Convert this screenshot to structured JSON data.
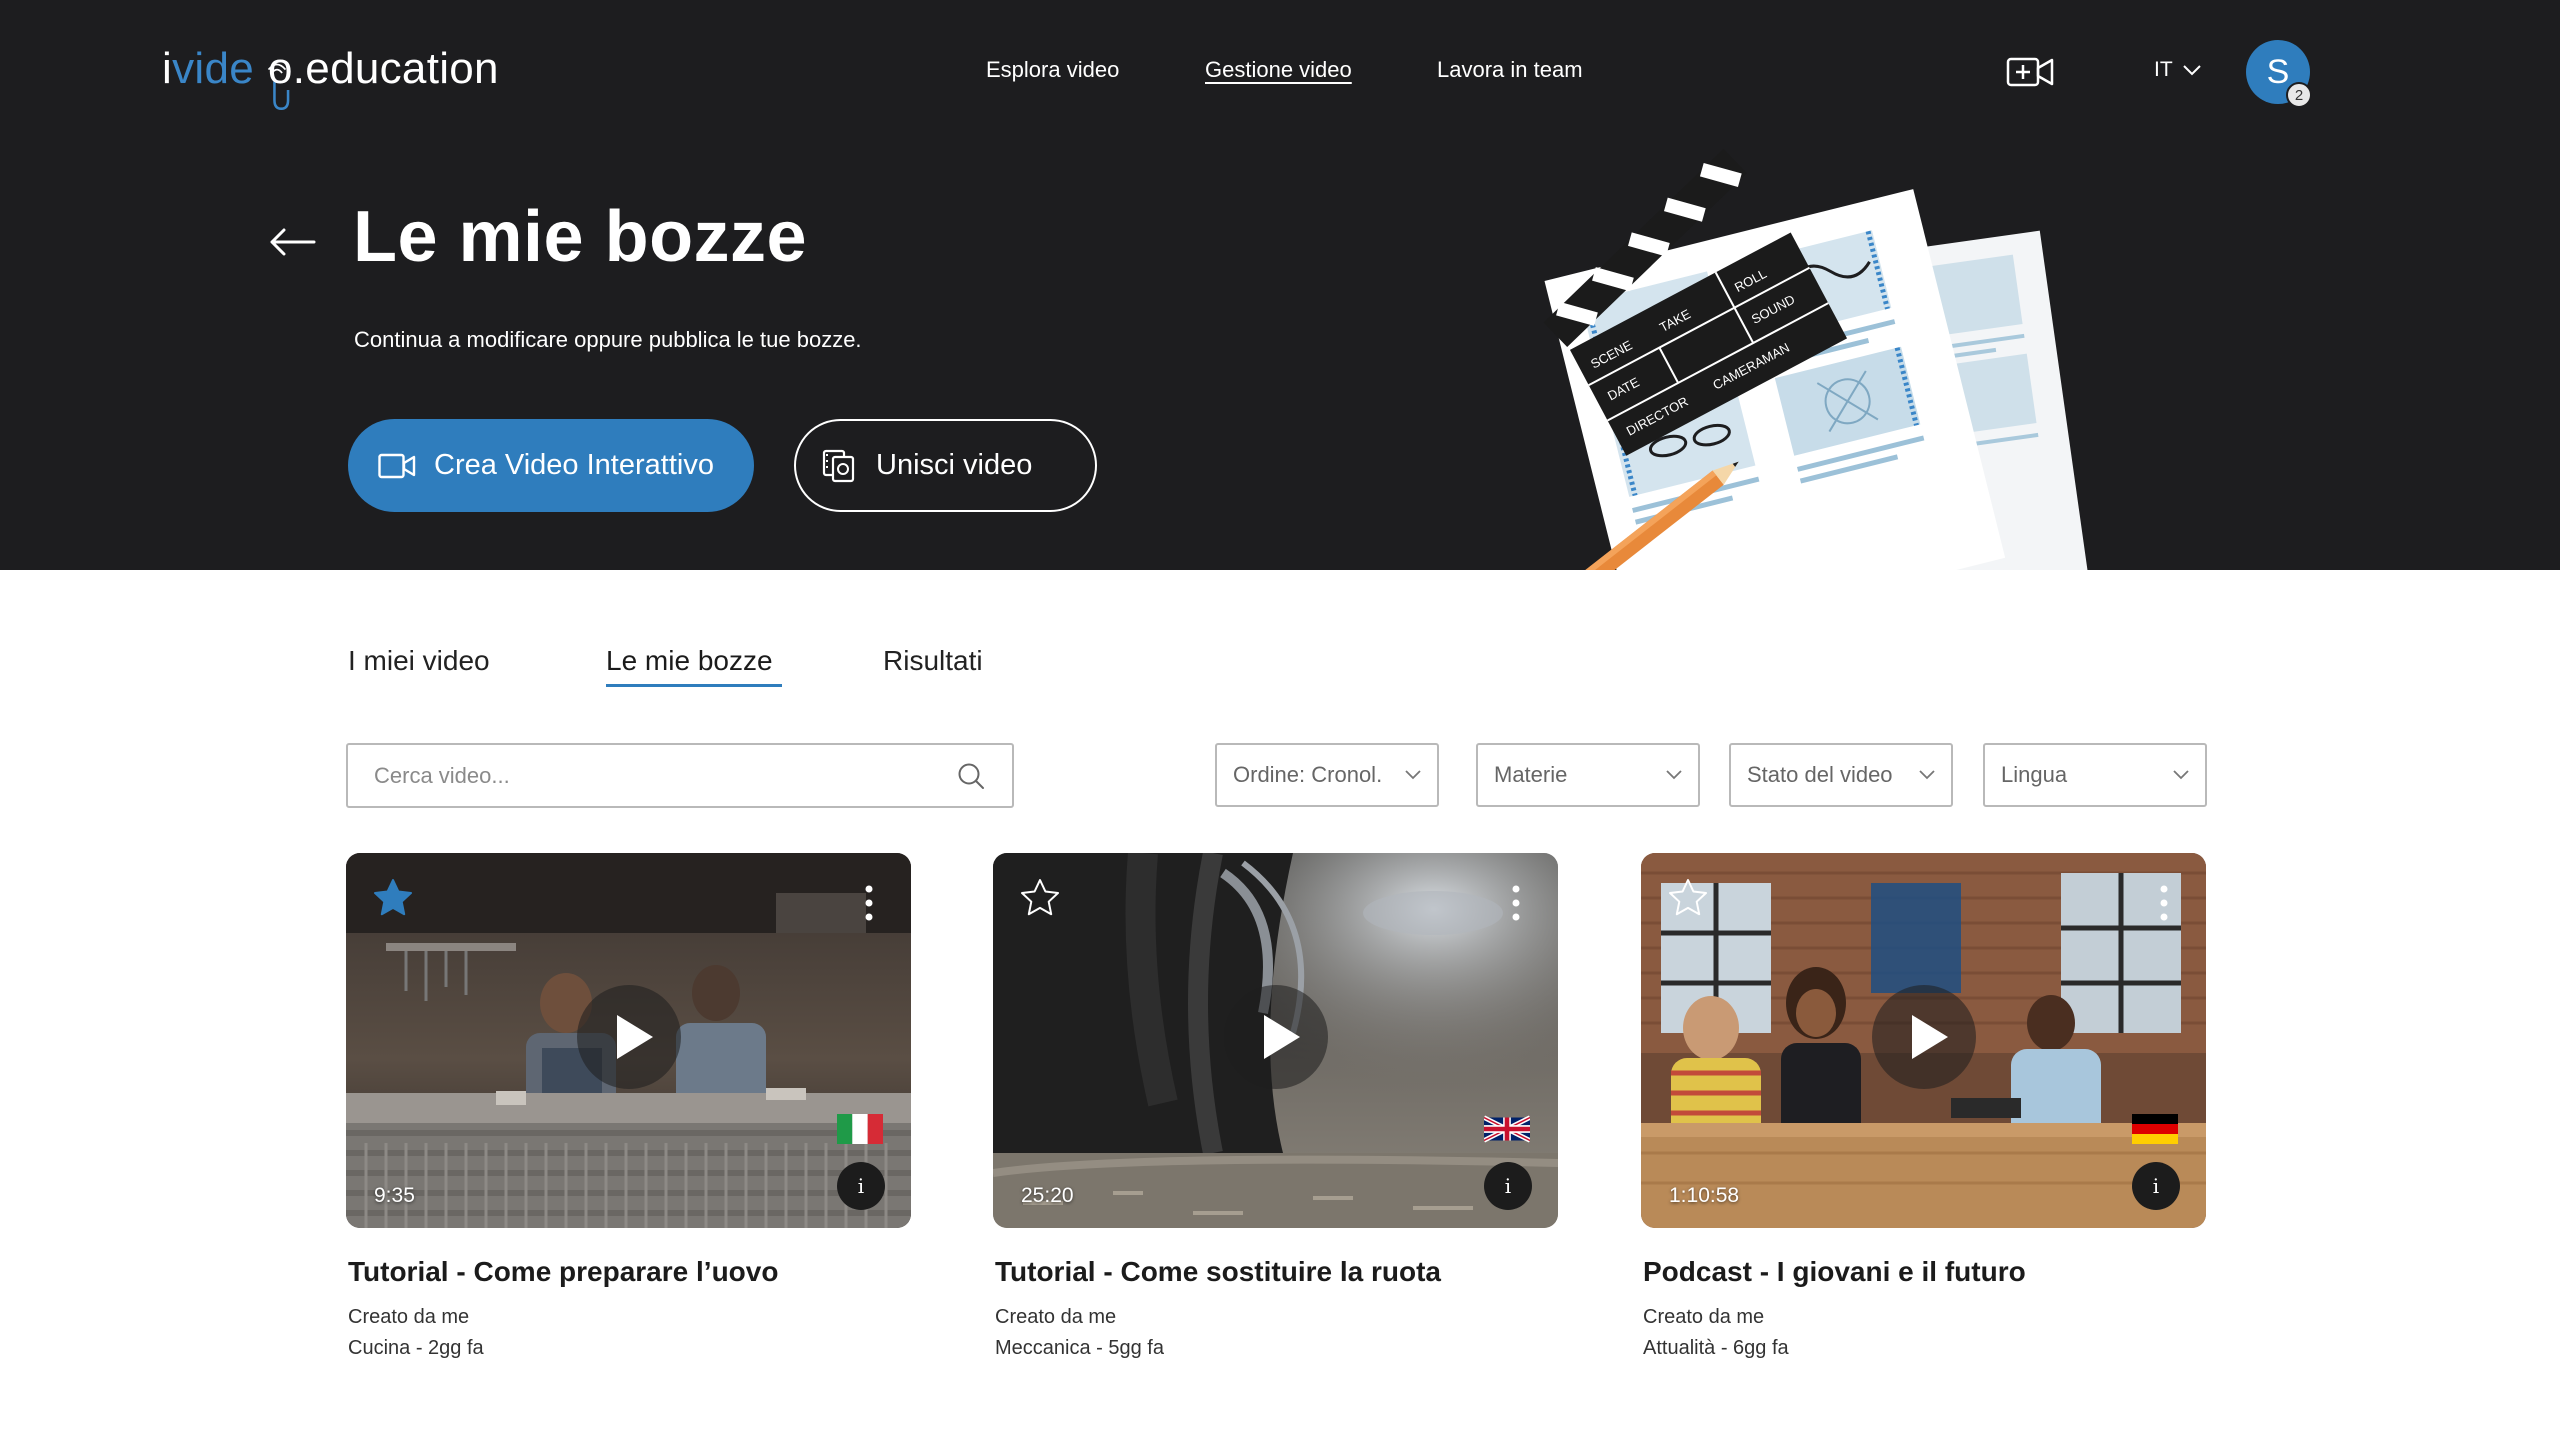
{
  "logo": {
    "part1": "i",
    "part2": "vide",
    "part3": "o",
    "part4": ".education"
  },
  "nav": {
    "items": [
      {
        "label": "Esplora video",
        "active": false
      },
      {
        "label": "Gestione video",
        "active": true
      },
      {
        "label": "Lavora in team",
        "active": false
      }
    ]
  },
  "header": {
    "language": "IT",
    "avatar_initial": "S",
    "notification_count": "2"
  },
  "hero": {
    "title": "Le mie bozze",
    "subtitle": "Continua a modificare oppure pubblica le tue bozze.",
    "primary_button": "Crea Video Interattivo",
    "secondary_button": "Unisci video",
    "clapper_labels": [
      "SCENE",
      "TAKE",
      "ROLL",
      "DATE",
      "SOUND",
      "DIRECTOR",
      "CAMERAMAN"
    ]
  },
  "tabs": [
    {
      "label": "I miei video",
      "active": false
    },
    {
      "label": "Le mie bozze",
      "active": true
    },
    {
      "label": "Risultati",
      "active": false
    }
  ],
  "filters": {
    "search_placeholder": "Cerca video...",
    "order": "Ordine: Cronol.",
    "subjects": "Materie",
    "status": "Stato del video",
    "language": "Lingua"
  },
  "cards": [
    {
      "title": "Tutorial - Come preparare l’uovo",
      "creator": "Creato da me",
      "meta": "Cucina - 2gg fa",
      "duration": "9:35",
      "favorite": true,
      "flag": "italy-flag-icon"
    },
    {
      "title": "Tutorial - Come sostituire la ruota",
      "creator": "Creato da me",
      "meta": "Meccanica - 5gg fa",
      "duration": "25:20",
      "favorite": false,
      "flag": "uk-flag-icon"
    },
    {
      "title": "Podcast - I giovani e il futuro",
      "creator": "Creato da me",
      "meta": "Attualità - 6gg fa",
      "duration": "1:10:58",
      "favorite": false,
      "flag": "germany-flag-icon"
    }
  ],
  "colors": {
    "hero_bg": "#1d1d1f",
    "accent": "#2f7dbd",
    "text": "#1b1b1b"
  }
}
